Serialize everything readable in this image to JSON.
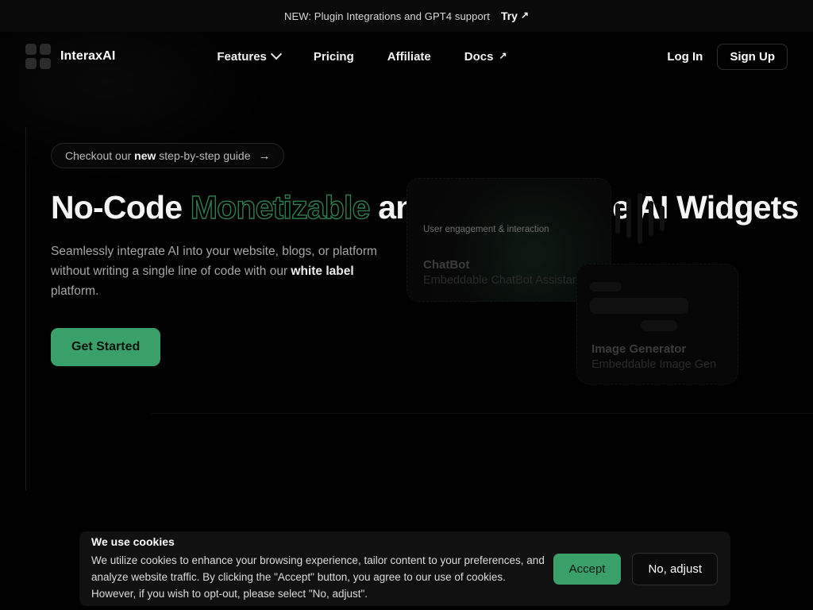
{
  "colors": {
    "background": "#000000",
    "accent_green": "#3aa069",
    "outline_green": "#2f7d4f",
    "announce_bar": "#0a0a0a",
    "cookie_banner": "#111111",
    "muted_text": "#a6a6a6"
  },
  "announcement": {
    "text": "NEW: Plugin Integrations and GPT4 support",
    "cta_label": "Try",
    "cta_icon": "arrow-up-right-icon"
  },
  "nav": {
    "brand": {
      "name": "InteraxAI",
      "logo_icon": "grid-squares-logo-icon"
    },
    "links": [
      {
        "label": "Features",
        "icon": "chevron-down-icon",
        "has_dropdown": true
      },
      {
        "label": "Pricing",
        "icon": "",
        "has_dropdown": false
      },
      {
        "label": "Affiliate",
        "icon": "",
        "has_dropdown": false
      },
      {
        "label": "Docs",
        "icon": "arrow-up-right-icon",
        "has_dropdown": false
      }
    ],
    "login_label": "Log In",
    "signup_label": "Sign Up"
  },
  "hero": {
    "pill": {
      "prefix": "Checkout our ",
      "emphasis": "new",
      "suffix": " step-by-step guide",
      "icon": "arrow-right-icon"
    },
    "title": {
      "part1": "No-Code ",
      "highlight": "Monetizable",
      "part2": " and Embeddable AI Widgets"
    },
    "subtitle": {
      "part1": "Seamlessly integrate AI into your website, blogs, or platform without writing a single line of code with our ",
      "emphasis": "white label",
      "part2": " platform."
    },
    "cta_label": "Get Started"
  },
  "hero_art": {
    "eyebrow": "User engagement & interaction",
    "cards": [
      {
        "title": "ChatBot",
        "description": "Embeddable ChatBot Assistant"
      },
      {
        "title": "Image Generator",
        "description": "Embeddable Image Gen"
      }
    ],
    "waveform_icon": "audio-waveform-icon"
  },
  "cookie_banner": {
    "title": "We use cookies",
    "body": "We utilize cookies to enhance your browsing experience, tailor content to your preferences, and analyze website traffic. By clicking the \"Accept\" button, you agree to our use of cookies. However, if you wish to opt-out, please select \"No, adjust\".",
    "accept_label": "Accept",
    "reject_label": "No, adjust"
  }
}
